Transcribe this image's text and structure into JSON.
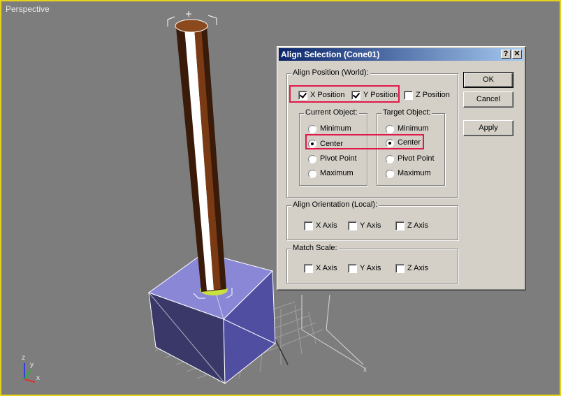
{
  "viewport": {
    "label": "Perspective"
  },
  "gizmo": {
    "z": "z",
    "y": "y",
    "x": "x"
  },
  "dialog": {
    "title": "Align Selection (Cone01)",
    "help_label": "?",
    "close_label": "✕",
    "align_position": {
      "title": "Align Position (World):",
      "x_label": "X Position",
      "x_checked": true,
      "y_label": "Y Position",
      "y_checked": true,
      "z_label": "Z Position",
      "z_checked": false
    },
    "current_object": {
      "title": "Current Object:",
      "options": [
        "Minimum",
        "Center",
        "Pivot Point",
        "Maximum"
      ],
      "selected": "Center"
    },
    "target_object": {
      "title": "Target Object:",
      "options": [
        "Minimum",
        "Center",
        "Pivot Point",
        "Maximum"
      ],
      "selected": "Center"
    },
    "align_orientation": {
      "title": "Align Orientation (Local):",
      "x_label": "X Axis",
      "y_label": "Y Axis",
      "z_label": "Z Axis"
    },
    "match_scale": {
      "title": "Match Scale:",
      "x_label": "X Axis",
      "y_label": "Y Axis",
      "z_label": "Z Axis"
    },
    "buttons": {
      "ok": "OK",
      "cancel": "Cancel",
      "apply": "Apply"
    }
  },
  "colors": {
    "title_bar": "#0a246a",
    "highlight": "#e0194a",
    "viewport_border": "#e6d21a",
    "box_fill": "#8a88d6",
    "cylinder": "#5a2a10"
  }
}
